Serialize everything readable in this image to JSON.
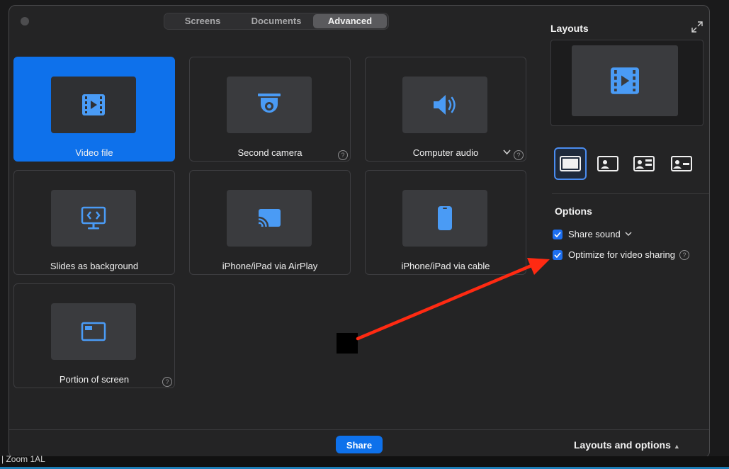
{
  "tabs": [
    "Screens",
    "Documents",
    "Advanced"
  ],
  "active_tab": "Advanced",
  "cards": [
    {
      "label": "Video file",
      "icon": "video-file-icon",
      "selected": true
    },
    {
      "label": "Second camera",
      "icon": "camera-icon",
      "help": "?"
    },
    {
      "label": "Computer audio",
      "icon": "speaker-icon",
      "help": "?"
    },
    {
      "label": "Slides as background",
      "icon": "slides-icon"
    },
    {
      "label": "iPhone/iPad via AirPlay",
      "icon": "airplay-icon"
    },
    {
      "label": "iPhone/iPad via cable",
      "icon": "phone-icon"
    },
    {
      "label": "Portion of screen",
      "icon": "portion-screen-icon",
      "help": "?"
    }
  ],
  "layouts": {
    "title": "Layouts"
  },
  "options": {
    "title": "Options",
    "share_sound": "Share sound",
    "optimize": "Optimize for video sharing",
    "help": "?"
  },
  "footer": {
    "share_label": "Share",
    "layouts_and_options": "Layouts and options"
  },
  "background_window": {
    "text": "| Zoom 1AL"
  },
  "colors": {
    "accent": "#0e71eb",
    "icon_blue": "#4a9bf5",
    "arrow": "#ff2a12"
  }
}
